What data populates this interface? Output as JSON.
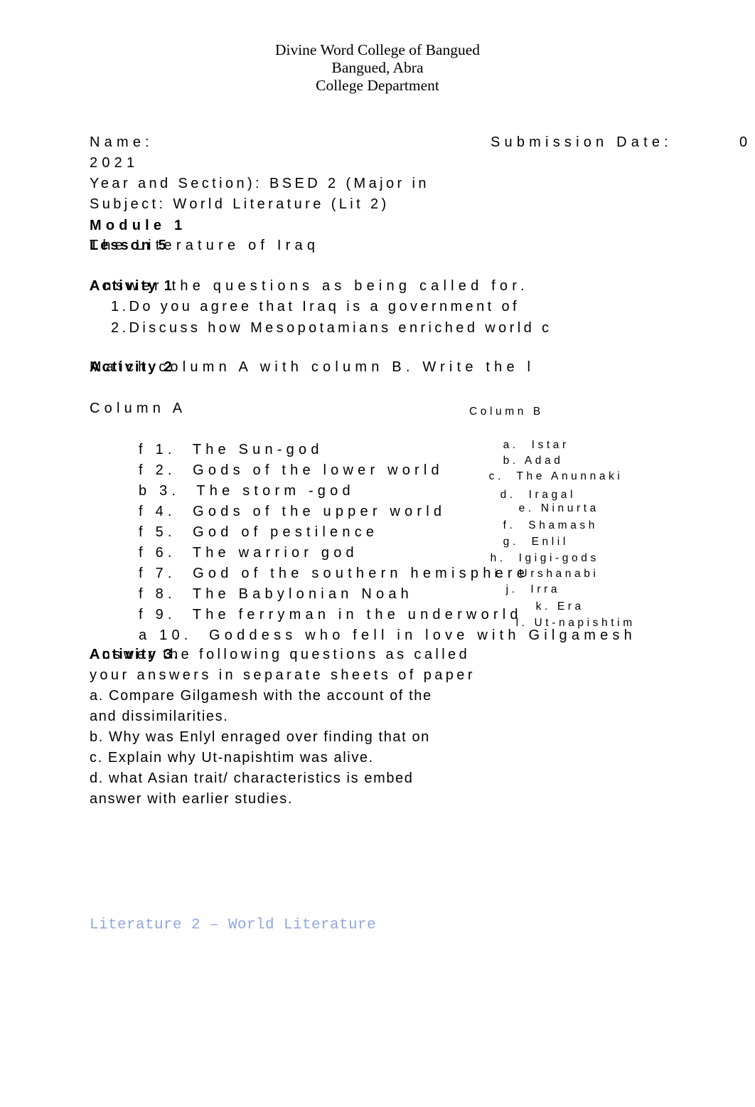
{
  "masthead": {
    "line1": "Divine Word College of Bangued",
    "line2": "Bangued, Abra",
    "line3": "College Department"
  },
  "info": {
    "name_label": "Name:",
    "submission_label": "Submission Date:",
    "submission_value": "0",
    "year_value": "2021",
    "year_section": "Year and Section): BSED 2 (Major in",
    "subject": "Subject: World Literature (Lit 2)",
    "module": "Module 1",
    "lesson_bold": "Lesson 5",
    "lesson_regular": "The Literature of Iraq"
  },
  "activity1": {
    "label": "Activity 1",
    "instruction": "Answer the questions as being called for.",
    "items": [
      "1.Do you agree that Iraq is a government of",
      "2.Discuss how Mesopotamians enriched world c"
    ]
  },
  "activity2": {
    "label": "Activity 2",
    "instruction": "Match column A with column B. Write the l",
    "column_a_header": "Column A",
    "column_b_header": "Column B",
    "column_a": [
      {
        "answer": "f",
        "number": "1.",
        "text": "The Sun-god"
      },
      {
        "answer": "f",
        "number": "2.",
        "text": "Gods of the lower world"
      },
      {
        "answer": "b",
        "number": "3.",
        "text": "The storm -god"
      },
      {
        "answer": "f",
        "number": "4.",
        "text": "Gods of the upper world"
      },
      {
        "answer": "f",
        "number": "5.",
        "text": "God of pestilence"
      },
      {
        "answer": "f",
        "number": "6.",
        "text": "The warrior god"
      },
      {
        "answer": "f",
        "number": "7.",
        "text": "God of the southern hemisphere"
      },
      {
        "answer": "f",
        "number": "8.",
        "text": "The Babylonian Noah"
      },
      {
        "answer": "f",
        "number": "9.",
        "text": "The ferryman in the underworld"
      },
      {
        "answer": "a",
        "number": "10.",
        "text": "Goddess who fell in love with Gilgamesh"
      }
    ],
    "column_b": [
      {
        "letter": "a.",
        "text": "Istar"
      },
      {
        "letter": "b.",
        "text": "Adad"
      },
      {
        "letter": "c.",
        "text": "The Anunnaki"
      },
      {
        "letter": "d.",
        "text": "Iragal"
      },
      {
        "letter": "e.",
        "text": "Ninurta"
      },
      {
        "letter": "f.",
        "text": "Shamash"
      },
      {
        "letter": "g.",
        "text": "Enlil"
      },
      {
        "letter": "h.",
        "text": "Igigi-gods"
      },
      {
        "letter": "i.",
        "text": "Urshanabi"
      },
      {
        "letter": "j.",
        "text": "Irra"
      },
      {
        "letter": "k.",
        "text": "Era"
      },
      {
        "letter": "l.",
        "text": "Ut-napishtim"
      }
    ]
  },
  "activity3": {
    "label": "Activity 3.",
    "instruction": "Answer the following questions as called",
    "instruction_cont": "your answers in separate sheets of paper",
    "items": [
      "a. Compare Gilgamesh with the account of the",
      "and dissimilarities.",
      "b. Why was Enlyl enraged over finding that on",
      "c. Explain why Ut-napishtim was alive.",
      "d. what Asian trait/ characteristics is embed",
      "answer with earlier studies."
    ]
  },
  "footer": {
    "text": "Literature 2 – World Literature",
    "color": "#8fa8dc"
  }
}
